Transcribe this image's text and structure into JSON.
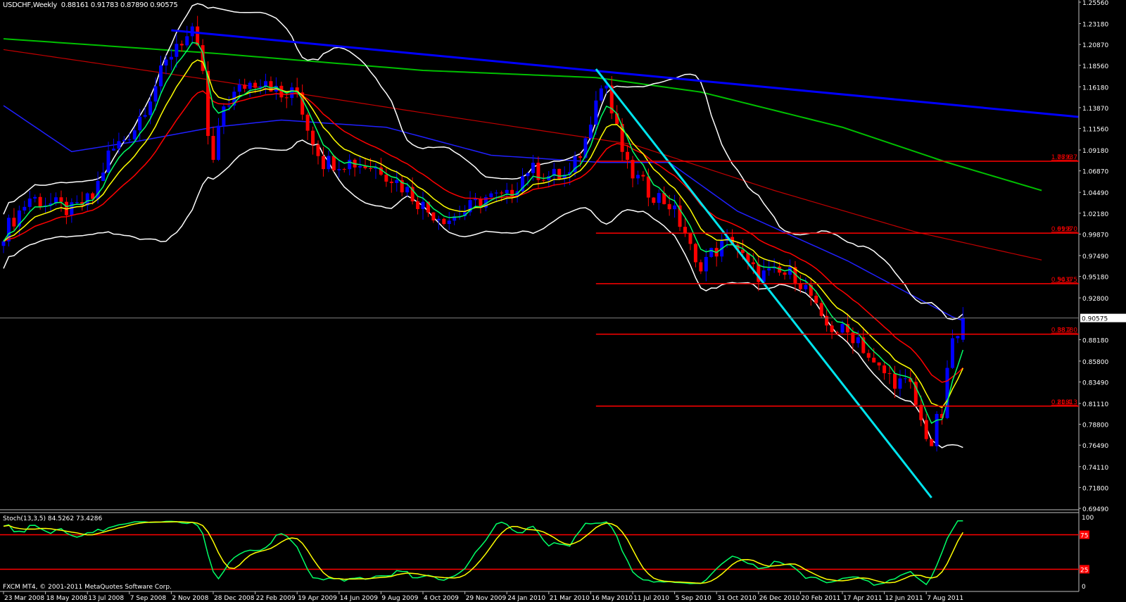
{
  "header": {
    "symbol": "USDCHF,Weekly",
    "ohlc": "0.88161 0.91783 0.87890 0.90575"
  },
  "indicator": {
    "label": "Stoch(13,3,5) 84.5262 73.4286",
    "levels": [
      {
        "value": 75,
        "label": "75"
      },
      {
        "value": 25,
        "label": "25"
      }
    ],
    "top": "100",
    "bottom": "0"
  },
  "footer": {
    "copyright": "FXCM MT4, © 2001-2011 MetaQuotes Software Corp."
  },
  "colors": {
    "bg": "#000000",
    "up": "#0000ff",
    "down": "#ff0000",
    "bb": "#ffffff",
    "ma5": "#00ff66",
    "ma10": "#ffff00",
    "ma20": "#ff0000",
    "trend": "#0000ff",
    "channel": "#00e5ee"
  },
  "chart_data": {
    "type": "candlestick",
    "ylim": [
      0.6949,
      1.2556
    ],
    "price_ticks": [
      "1.25560",
      "1.23180",
      "1.20870",
      "1.18560",
      "1.16180",
      "1.13870",
      "1.11560",
      "1.09180",
      "1.06870",
      "1.04490",
      "1.02180",
      "0.99870",
      "0.97490",
      "0.95180",
      "0.92800",
      "0.90575",
      "0.88180",
      "0.85800",
      "0.83490",
      "0.81110",
      "0.78800",
      "0.76490",
      "0.74110",
      "0.71800",
      "0.69490"
    ],
    "current_price": "0.90575",
    "date_labels": [
      "23 Mar 2008",
      "18 May 2008",
      "13 Jul 2008",
      "7 Sep 2008",
      "2 Nov 2008",
      "28 Dec 2008",
      "22 Feb 2009",
      "19 Apr 2009",
      "14 Jun 2009",
      "9 Aug 2009",
      "4 Oct 2009",
      "29 Nov 2009",
      "24 Jan 2010",
      "21 Mar 2010",
      "16 May 2010",
      "11 Jul 2010",
      "5 Sep 2010",
      "31 Oct 2010",
      "26 Dec 2010",
      "20 Feb 2011",
      "17 Apr 2011",
      "12 Jun 2011",
      "7 Aug 2011"
    ],
    "close_anchors": [
      [
        0,
        1.0006
      ],
      [
        5,
        1.039
      ],
      [
        9,
        1.032
      ],
      [
        13,
        1.024
      ],
      [
        17,
        1.039
      ],
      [
        20,
        1.086
      ],
      [
        25,
        1.117
      ],
      [
        29,
        1.164
      ],
      [
        33,
        1.211
      ],
      [
        36,
        1.219
      ],
      [
        38,
        1.18
      ],
      [
        39,
        1.102
      ],
      [
        40,
        1.079
      ],
      [
        42,
        1.141
      ],
      [
        46,
        1.164
      ],
      [
        50,
        1.172
      ],
      [
        53,
        1.149
      ],
      [
        56,
        1.156
      ],
      [
        58,
        1.117
      ],
      [
        61,
        1.079
      ],
      [
        66,
        1.079
      ],
      [
        72,
        1.071
      ],
      [
        77,
        1.047
      ],
      [
        81,
        1.024
      ],
      [
        85,
        1.016
      ],
      [
        88,
        1.024
      ],
      [
        92,
        1.039
      ],
      [
        96,
        1.039
      ],
      [
        100,
        1.071
      ],
      [
        104,
        1.063
      ],
      [
        108,
        1.063
      ],
      [
        111,
        1.102
      ],
      [
        113,
        1.156
      ],
      [
        115,
        1.164
      ],
      [
        116,
        1.133
      ],
      [
        119,
        1.071
      ],
      [
        123,
        1.047
      ],
      [
        127,
        1.032
      ],
      [
        130,
        1.001
      ],
      [
        132,
        0.962
      ],
      [
        135,
        0.977
      ],
      [
        139,
        0.993
      ],
      [
        142,
        0.962
      ],
      [
        144,
        0.954
      ],
      [
        147,
        0.954
      ],
      [
        151,
        0.954
      ],
      [
        154,
        0.93
      ],
      [
        156,
        0.899
      ],
      [
        160,
        0.891
      ],
      [
        163,
        0.884
      ],
      [
        166,
        0.852
      ],
      [
        170,
        0.837
      ],
      [
        173,
        0.829
      ],
      [
        175,
        0.79
      ],
      [
        177,
        0.766
      ],
      [
        178,
        0.79
      ],
      [
        179,
        0.798
      ],
      [
        181,
        0.884
      ],
      [
        182,
        0.8818
      ],
      [
        183,
        0.90575
      ]
    ],
    "ma_blue": [
      [
        0,
        1.141
      ],
      [
        13,
        1.09
      ],
      [
        26,
        1.102
      ],
      [
        40,
        1.117
      ],
      [
        53,
        1.125
      ],
      [
        73,
        1.117
      ],
      [
        93,
        1.086
      ],
      [
        114,
        1.078
      ],
      [
        127,
        1.078
      ],
      [
        140,
        1.024
      ],
      [
        161,
        0.969
      ],
      [
        181,
        0.907
      ],
      [
        183,
        0.903
      ]
    ],
    "ma_red_long": [
      [
        0,
        1.203
      ],
      [
        40,
        1.169
      ],
      [
        80,
        1.133
      ],
      [
        120,
        1.098
      ],
      [
        147,
        1.047
      ],
      [
        174,
        1.001
      ],
      [
        198,
        0.97
      ]
    ],
    "ma_green_long": [
      [
        0,
        1.215
      ],
      [
        40,
        1.199
      ],
      [
        80,
        1.18
      ],
      [
        113,
        1.172
      ],
      [
        133,
        1.156
      ],
      [
        160,
        1.117
      ],
      [
        180,
        1.078
      ],
      [
        198,
        1.047
      ]
    ],
    "trendline_blue": [
      [
        32,
        1.2244
      ],
      [
        205,
        1.1285
      ]
    ],
    "trendline_cyan": [
      [
        113,
        1.1815
      ],
      [
        177,
        0.7067
      ]
    ],
    "fibonacci": {
      "start_week": 113,
      "levels": [
        {
          "pct": "78.6",
          "price": "1.07937"
        },
        {
          "pct": "61.8",
          "price": "0.99970"
        },
        {
          "pct": "50.0",
          "price": "0.94375"
        },
        {
          "pct": "38.2",
          "price": "0.88780"
        },
        {
          "pct": "21.4",
          "price": "0.80813"
        }
      ]
    }
  }
}
